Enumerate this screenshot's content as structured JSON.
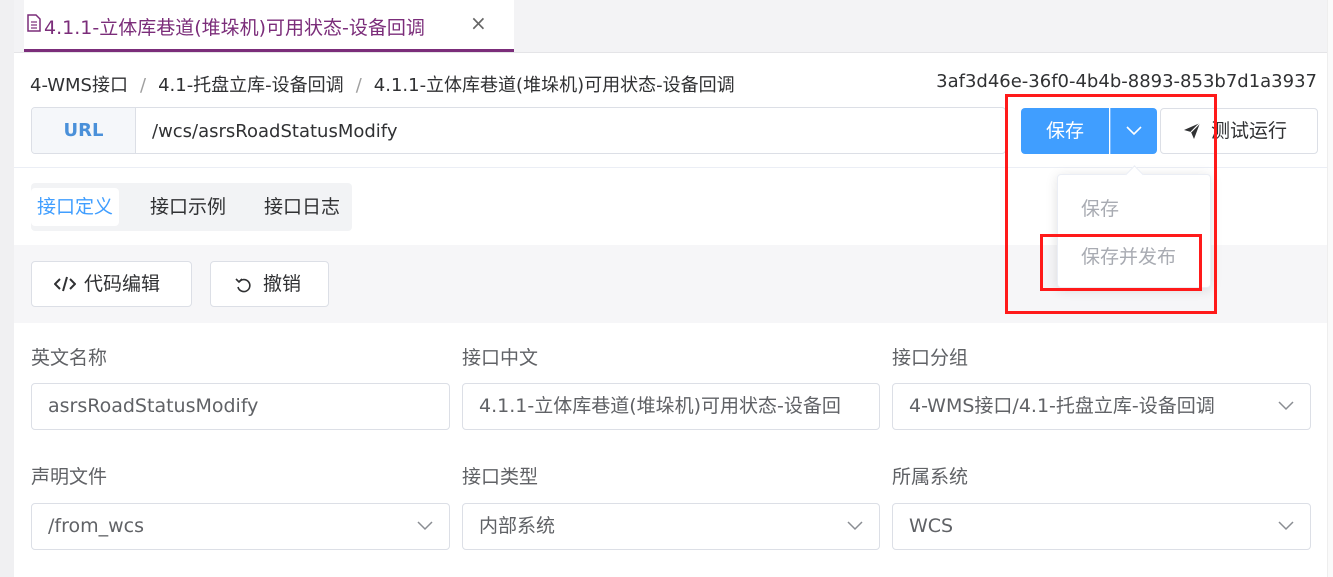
{
  "tab": {
    "title": "4.1.1-立体库巷道(堆垛机)可用状态-设备回调",
    "close_glyph": "×"
  },
  "breadcrumb": {
    "items": [
      "4-WMS接口",
      "4.1-托盘立库-设备回调",
      "4.1.1-立体库巷道(堆垛机)可用状态-设备回调"
    ],
    "separator": "/"
  },
  "api_id": "3af3d46e-36f0-4b4b-8893-853b7d1a3937",
  "url": {
    "label": "URL",
    "value": "/wcs/asrsRoadStatusModify"
  },
  "actions": {
    "save": "保存",
    "test_run": "测试运行"
  },
  "dropdown": {
    "items": [
      "保存",
      "保存并发布"
    ]
  },
  "subtabs": [
    "接口定义",
    "接口示例",
    "接口日志"
  ],
  "toolbar": {
    "code_edit": "代码编辑",
    "undo": "撤销"
  },
  "form": {
    "english_name": {
      "label": "英文名称",
      "value": "asrsRoadStatusModify"
    },
    "chinese_name": {
      "label": "接口中文",
      "value": "4.1.1-立体库巷道(堆垛机)可用状态-设备回"
    },
    "group": {
      "label": "接口分组",
      "value": "4-WMS接口/4.1-托盘立库-设备回调"
    },
    "declare_file": {
      "label": "声明文件",
      "value": "/from_wcs"
    },
    "api_type": {
      "label": "接口类型",
      "value": "内部系统"
    },
    "system": {
      "label": "所属系统",
      "value": "WCS"
    }
  },
  "colors": {
    "primary": "#409eff",
    "tab_accent": "#7b2d7a",
    "annotation": "#ff1a1a"
  }
}
